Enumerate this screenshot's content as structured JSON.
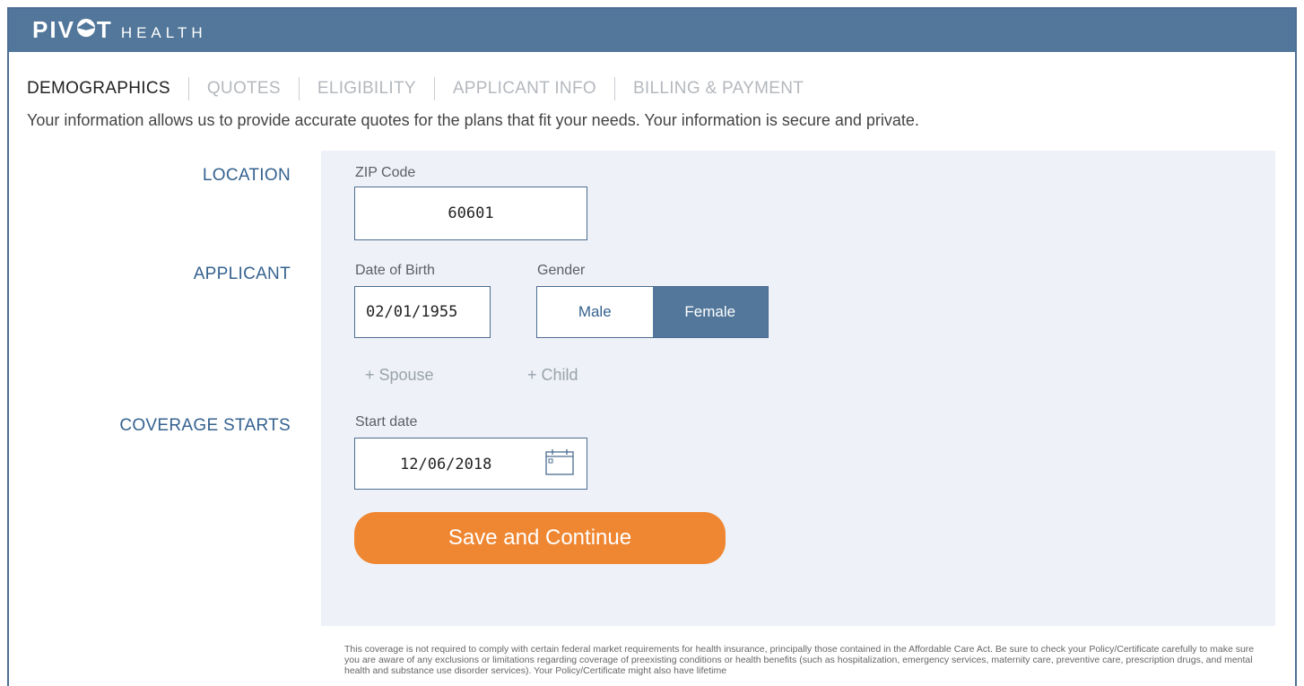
{
  "brand": {
    "main_left": "PIV",
    "main_right": "T",
    "sub": "HEALTH"
  },
  "nav": {
    "items": [
      {
        "label": "DEMOGRAPHICS",
        "active": true
      },
      {
        "label": "QUOTES",
        "active": false
      },
      {
        "label": "ELIGIBILITY",
        "active": false
      },
      {
        "label": "APPLICANT INFO",
        "active": false
      },
      {
        "label": "BILLING & PAYMENT",
        "active": false
      }
    ]
  },
  "intro": "Your information allows us to provide accurate quotes for the plans that fit your needs. Your information is secure and private.",
  "location": {
    "section_label": "LOCATION",
    "zip_label": "ZIP Code",
    "zip_value": "60601"
  },
  "applicant": {
    "section_label": "APPLICANT",
    "dob_label": "Date of Birth",
    "dob_value": "02/01/1955",
    "gender_label": "Gender",
    "gender_options": [
      "Male",
      "Female"
    ],
    "gender_selected": "Female",
    "add_spouse": "+ Spouse",
    "add_child": "+ Child"
  },
  "coverage": {
    "section_label": "COVERAGE STARTS",
    "start_label": "Start date",
    "start_value": "12/06/2018",
    "icon": "calendar-icon"
  },
  "save_button": "Save and Continue",
  "disclaimer": "This coverage is not required to comply with certain federal market requirements for health insurance, principally those contained in the Affordable Care Act. Be sure to check your Policy/Certificate carefully to make sure you are aware of any exclusions or limitations regarding coverage of preexisting conditions or health benefits (such as hospitalization, emergency services, maternity care, preventive care, prescription drugs, and mental health and substance use disorder services). Your Policy/Certificate might also have lifetime",
  "colors": {
    "header": "#52779a",
    "accent": "#ef8732",
    "panel": "#eef2f8",
    "label": "#35628f"
  }
}
